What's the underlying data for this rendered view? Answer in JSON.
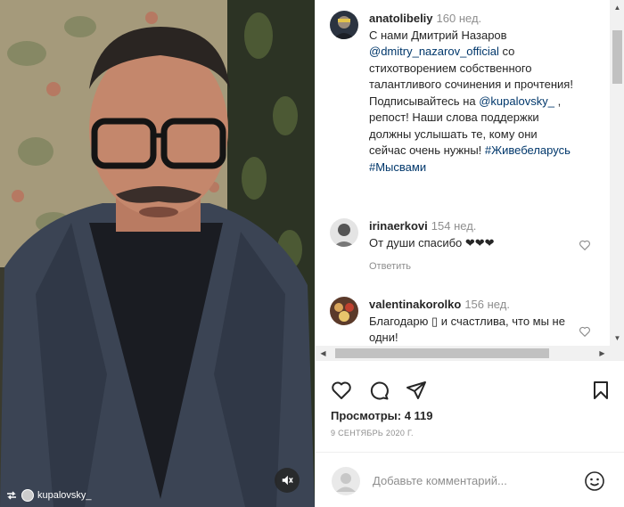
{
  "video": {
    "repost_handle": "kupalovsky_",
    "icons": {
      "repost": "repost-icon",
      "mute": "speaker-muted-icon"
    }
  },
  "post": {
    "author": "anatolibeliy",
    "time": "160 нед.",
    "caption": {
      "text1": "С нами Дмитрий Назаров ",
      "mention1": "@dmitry_nazarov_official",
      "text2": " со стихотворением собственного талантливого сочинения и прочтения! Подписывайтесь на ",
      "mention2": "@kupalovsky_",
      "text3": " , репост! Наши слова поддержки должны услышать те, кому они сейчас очень нужны! ",
      "hashtag1": "#Живебеларусь",
      "hashtag2": "#Мысвами"
    }
  },
  "comments": [
    {
      "user": "irinaerkovi",
      "time": "154 нед.",
      "text": "От души спасибо ❤❤❤",
      "reply": "Ответить"
    },
    {
      "user": "valentinakorolko",
      "time": "156 нед.",
      "text": "Благодарю ▯ и счастлива, что мы не одни!"
    }
  ],
  "stats": {
    "views_label": "Просмотры: 4 119",
    "date": "9 СЕНТЯБРЬ 2020 Г."
  },
  "comment_box": {
    "placeholder": "Добавьте комментарий..."
  },
  "colors": {
    "link": "#00376b",
    "muted": "#8e8e8e",
    "text": "#262626"
  }
}
